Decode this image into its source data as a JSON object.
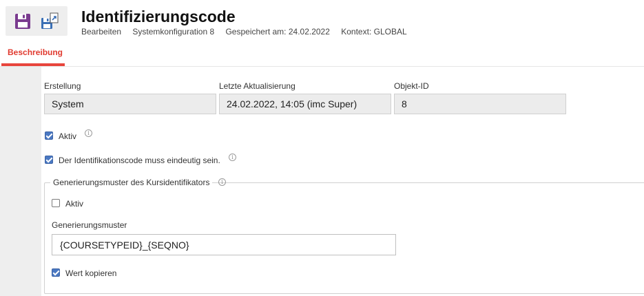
{
  "toolbar": {
    "save_icon": "floppy-disk-icon",
    "save_as_icon": "floppy-export-icon",
    "colors": {
      "save": "#7a3b8f",
      "save_as": "#3a6fb5",
      "background": "#eeeeee"
    }
  },
  "header": {
    "title": "Identifizierungscode",
    "meta": {
      "mode": "Bearbeiten",
      "config": "Systemkonfiguration 8",
      "saved": "Gespeichert am: 24.02.2022",
      "context": "Kontext: GLOBAL"
    }
  },
  "tabs": [
    {
      "label": "Beschreibung",
      "active": true
    }
  ],
  "accent_color": "#e8453c",
  "info": {
    "creation": {
      "label": "Erstellung",
      "value": "System"
    },
    "last_update": {
      "label": "Letzte Aktualisierung",
      "value": "24.02.2022, 14:05 (imc Super)"
    },
    "object_id": {
      "label": "Objekt-ID",
      "value": "8"
    }
  },
  "options": {
    "active": {
      "label": "Aktiv",
      "checked": true
    },
    "unique": {
      "label": "Der Identifikationscode muss eindeutig sein.",
      "checked": true
    }
  },
  "pattern_group": {
    "legend": "Generierungsmuster des Kursidentifikators",
    "active": {
      "label": "Aktiv",
      "checked": false
    },
    "pattern": {
      "label": "Generierungsmuster",
      "value": "{COURSETYPEID}_{SEQNO}"
    },
    "copy_value": {
      "label": "Wert kopieren",
      "checked": true
    }
  },
  "icons": {
    "info": "info-icon",
    "info_glyph": "i"
  }
}
